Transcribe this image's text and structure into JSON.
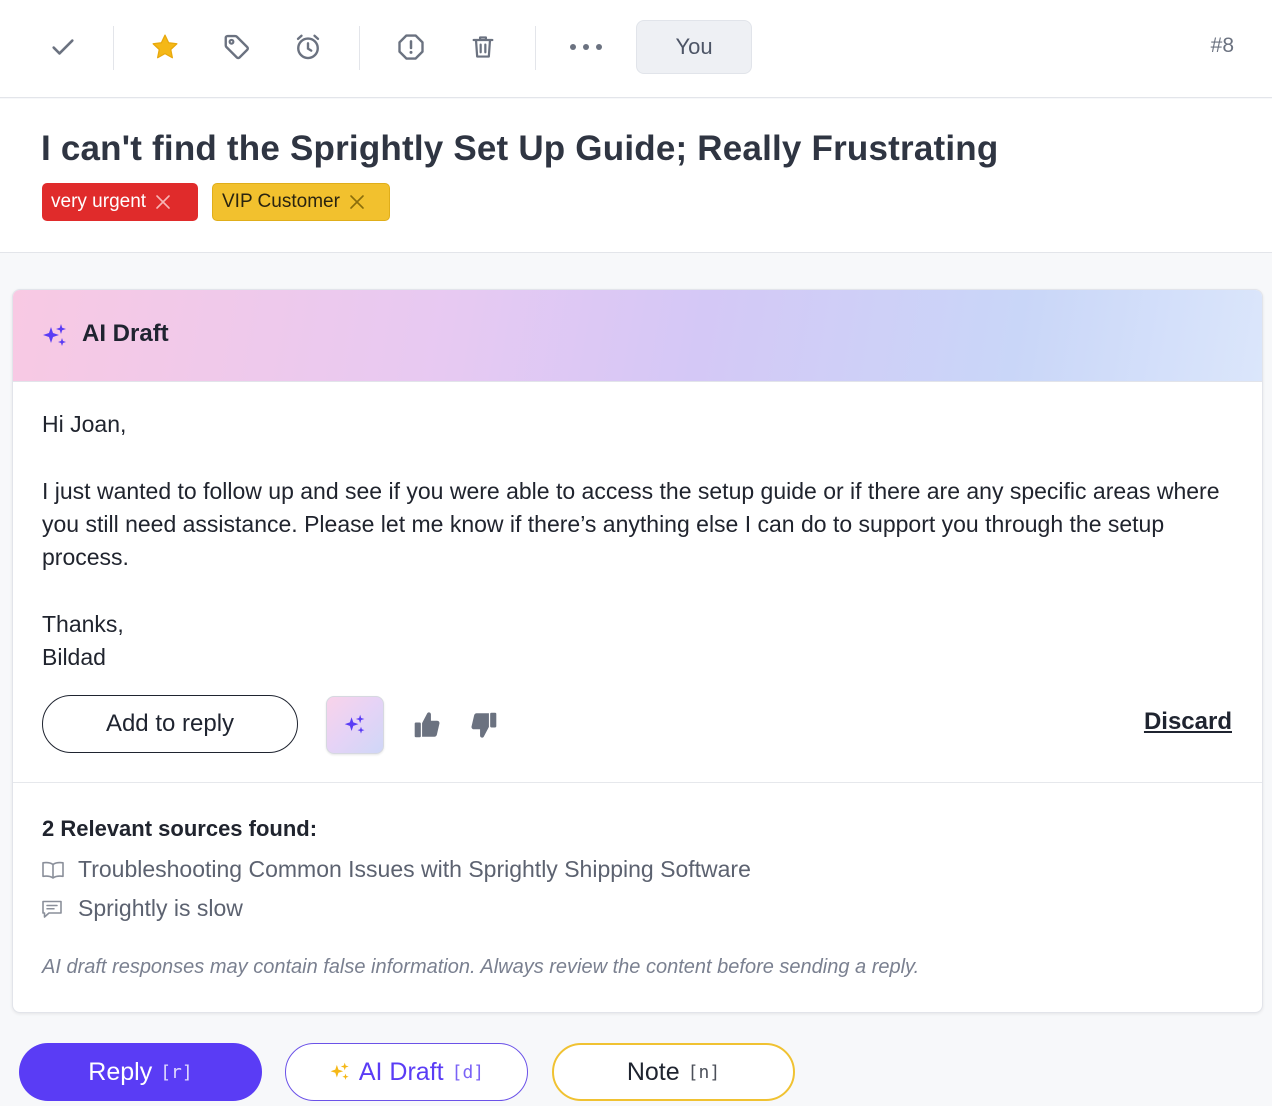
{
  "toolbar": {
    "assignee_label": "You",
    "ticket_number": "#8",
    "icons": [
      "check-icon",
      "star-icon",
      "tag-icon",
      "alarm-clock-icon",
      "alert-icon",
      "trash-icon",
      "more-icon"
    ]
  },
  "ticket": {
    "title": "I can't find the Sprightly Set Up Guide; Really Frustrating",
    "tags": [
      {
        "label": "very urgent",
        "color": "#e02b2b"
      },
      {
        "label": "VIP Customer",
        "color": "#f2c12e"
      }
    ]
  },
  "ai_draft": {
    "header": "AI Draft",
    "greeting": "Hi Joan,",
    "body": "I just wanted to follow up and see if you were able to access the setup guide or if there are any specific areas where you still need assistance. Please let me know if there’s anything else I can do to support you through the setup process.",
    "closing": "Thanks,",
    "signature": "Bildad",
    "add_to_reply_label": "Add to reply",
    "discard_label": "Discard",
    "sources_title": "2 Relevant sources found:",
    "sources": [
      {
        "label": "Troubleshooting Common Issues with Sprightly Shipping Software",
        "icon": "book-icon"
      },
      {
        "label": "Sprightly is slow",
        "icon": "message-icon"
      }
    ],
    "disclaimer": "AI draft responses may contain false information. Always review the content before sending a reply."
  },
  "actions": {
    "reply": {
      "label": "Reply",
      "shortcut": "[r]"
    },
    "ai_draft": {
      "label": "AI Draft",
      "shortcut": "[d]"
    },
    "note": {
      "label": "Note",
      "shortcut": "[n]"
    }
  },
  "colors": {
    "accent": "#5a3cf5",
    "urgent": "#e02b2b",
    "vip": "#f2c12e"
  }
}
